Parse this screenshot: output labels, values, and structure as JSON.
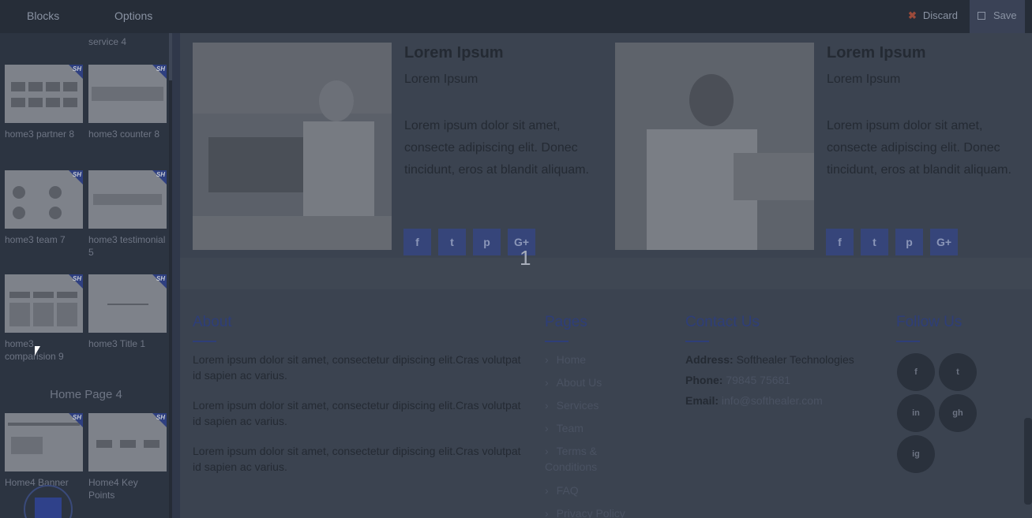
{
  "topbar": {
    "tabs": [
      "Blocks",
      "Options"
    ],
    "discard_label": "Discard",
    "save_label": "Save"
  },
  "sidebar": {
    "top_caption": "service 4",
    "blocks": [
      {
        "label": "home3 partner 8"
      },
      {
        "label": "home3 counter 8"
      },
      {
        "label": "home3 team 7"
      },
      {
        "label": "home3 testimonial 5"
      },
      {
        "label": "home3 comparision 9"
      },
      {
        "label": "home3 Title 1"
      }
    ],
    "group_title": "Home Page 4",
    "blocks2": [
      {
        "label": "Home4 Banner"
      },
      {
        "label": "Home4 Key Points"
      }
    ],
    "badge": "SH"
  },
  "team": [
    {
      "name": "Lorem Ipsum",
      "role": "Lorem Ipsum",
      "bio": "Lorem ipsum dolor sit amet, consecte adipiscing elit. Donec tincidunt, eros at blandit aliquam."
    },
    {
      "name": "Lorem Ipsum",
      "role": "Lorem Ipsum",
      "bio": "Lorem ipsum dolor sit amet, consecte adipiscing elit. Donec tincidunt, eros at blandit aliquam."
    }
  ],
  "social_glyphs": [
    "f",
    "t",
    "p",
    "G+"
  ],
  "page_number": "1",
  "footer": {
    "about": {
      "title": "About",
      "paragraphs": [
        "Lorem ipsum dolor sit amet, consectetur dipiscing elit.Cras volutpat id sapien ac varius.",
        "Lorem ipsum dolor sit amet, consectetur dipiscing elit.Cras volutpat id sapien ac varius.",
        "Lorem ipsum dolor sit amet, consectetur dipiscing elit.Cras volutpat id sapien ac varius."
      ]
    },
    "pages": {
      "title": "Pages",
      "links": [
        "Home",
        "About Us",
        "Services",
        "Team",
        "Terms & Conditions",
        "FAQ",
        "Privacy Policy"
      ]
    },
    "contact": {
      "title": "Contact Us",
      "address_label": "Address:",
      "address": "Softhealer Technologies",
      "phone_label": "Phone:",
      "phone": "79845 75681",
      "email_label": "Email:",
      "email": "info@softhealer.com"
    },
    "follow": {
      "title": "Follow Us",
      "icons": [
        "f",
        "t",
        "in",
        "gh",
        "ig"
      ]
    }
  }
}
